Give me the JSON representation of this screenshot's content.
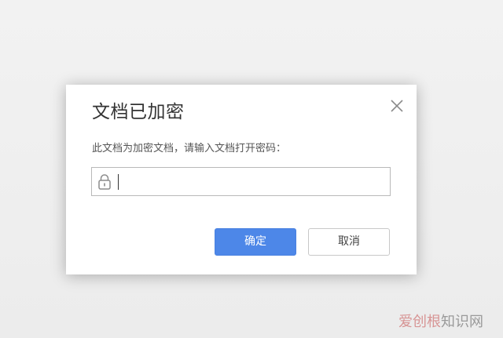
{
  "dialog": {
    "title": "文档已加密",
    "message": "此文档为加密文档，请输入文档打开密码：",
    "password_value": "",
    "ok_label": "确定",
    "cancel_label": "取消"
  },
  "icons": {
    "close": "close-icon",
    "lock": "lock-icon"
  },
  "colors": {
    "primary_button": "#4d87e8",
    "background": "#efefef"
  },
  "watermark": {
    "accent_text": "爱创根",
    "rest_text": "知识网"
  }
}
